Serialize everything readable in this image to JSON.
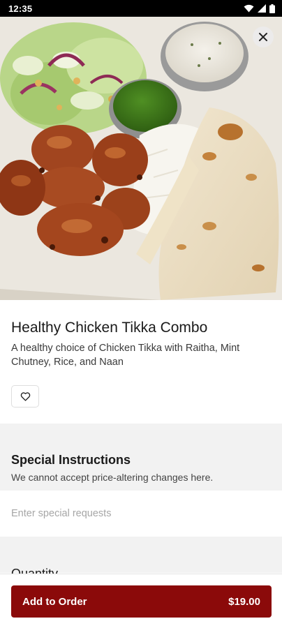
{
  "status_bar": {
    "time": "12:35"
  },
  "item": {
    "title": "Healthy Chicken Tikka Combo",
    "description": "A healthy choice of Chicken Tikka  with Raitha, Mint Chutney, Rice, and Naan"
  },
  "special_instructions": {
    "title": "Special Instructions",
    "subtitle": "We cannot accept price-altering changes here.",
    "placeholder": "Enter special requests"
  },
  "quantity": {
    "label": "Quantity"
  },
  "order_button": {
    "label": "Add to Order",
    "price": "$19.00"
  },
  "colors": {
    "accent": "#8b0a0a"
  },
  "icons": [
    "wifi-icon",
    "signal-icon",
    "battery-icon",
    "close-icon",
    "heart-icon"
  ]
}
